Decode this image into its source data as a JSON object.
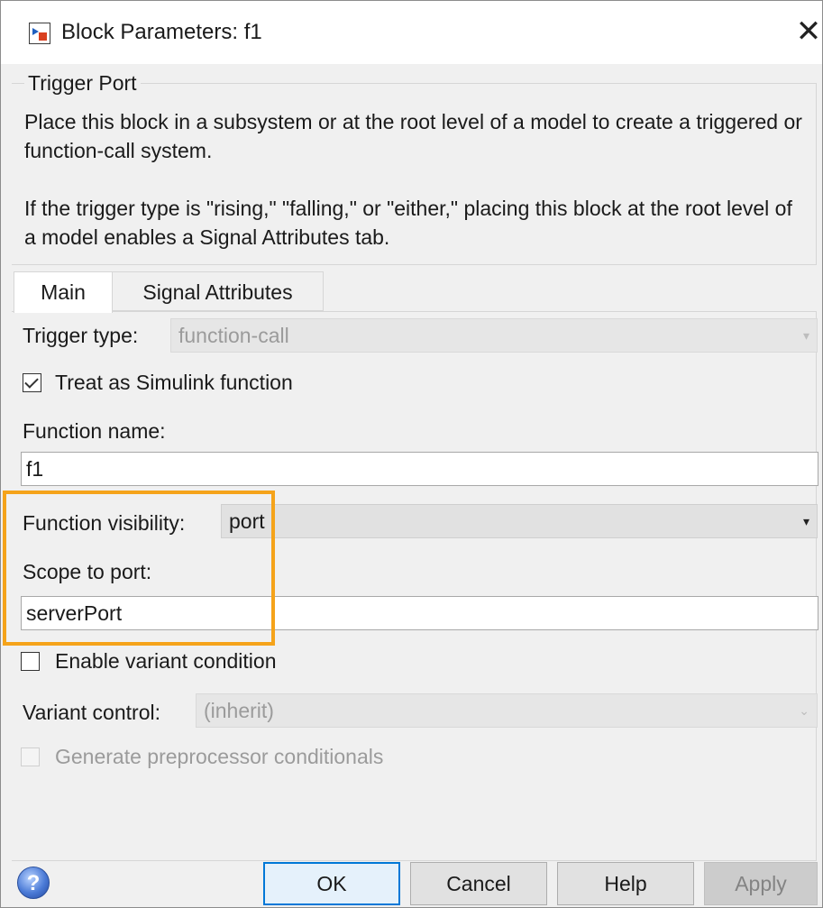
{
  "window": {
    "title": "Block Parameters: f1",
    "icon": "simulink-block-icon",
    "close_icon": "close-icon",
    "close_glyph": "✕"
  },
  "block": {
    "group_title": "Trigger Port",
    "description_1": "Place this block in a subsystem or at the root level of a model to create a triggered or function-call system.",
    "description_2": "If the trigger type is \"rising,\" \"falling,\" or \"either,\" placing this block at the root level of a model enables a Signal Attributes tab."
  },
  "tabs": [
    {
      "label": "Main",
      "selected": true
    },
    {
      "label": "Signal Attributes",
      "selected": false
    }
  ],
  "main": {
    "trigger_type": {
      "label": "Trigger type:",
      "value": "function-call",
      "enabled": false
    },
    "treat_as_simulink_function": {
      "label": "Treat as Simulink function",
      "checked": true
    },
    "function_name": {
      "label": "Function name:",
      "value": "f1"
    },
    "function_visibility": {
      "label": "Function visibility:",
      "value": "port",
      "enabled": true
    },
    "scope_to_port": {
      "label": "Scope to port:",
      "value": "serverPort"
    },
    "enable_variant_condition": {
      "label": "Enable variant condition",
      "checked": false
    },
    "variant_control": {
      "label": "Variant control:",
      "value": "(inherit)",
      "enabled": false
    },
    "generate_preprocessor_conditionals": {
      "label": "Generate preprocessor conditionals",
      "checked": false,
      "enabled": false
    }
  },
  "highlight_color": "#f5a31a",
  "buttons": {
    "help_icon": "help-icon",
    "help_glyph": "?",
    "ok": "OK",
    "cancel": "Cancel",
    "help": "Help",
    "apply": "Apply"
  }
}
